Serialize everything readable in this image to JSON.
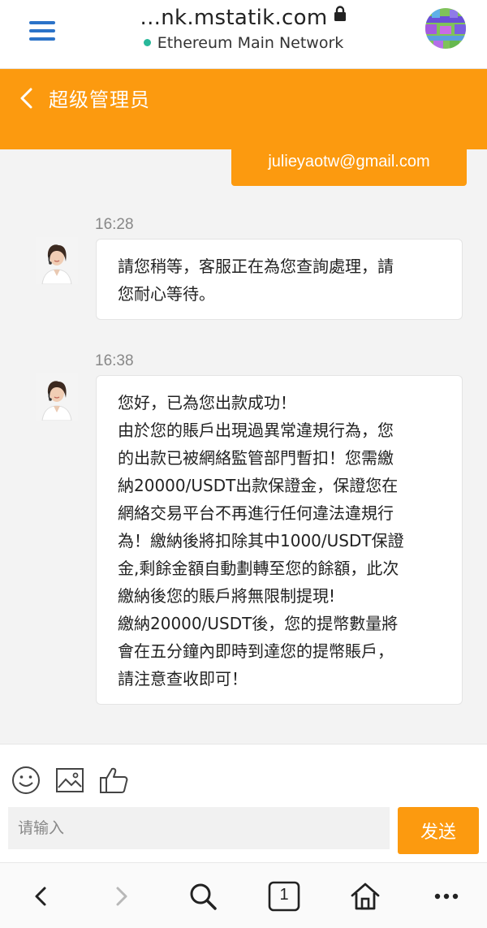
{
  "browser": {
    "url": "...nk.mstatik.com",
    "network": "Ethereum Main Network",
    "accent_color": "#2b73c8",
    "network_status_color": "#28b89a"
  },
  "chat_header": {
    "title": "超级管理员",
    "background_color": "#fc9a0f"
  },
  "messages": {
    "sent": {
      "text": "julieyaotw@gmail.com"
    },
    "received": [
      {
        "time": "16:28",
        "lines": [
          "請您稍等，客服正在為您查詢處理，請",
          "您耐心等待。"
        ]
      },
      {
        "time": "16:38",
        "lines": [
          "您好，已為您出款成功！",
          "由於您的賬戶出現過異常違規行為，您",
          "的出款已被網絡監管部門暫扣！您需繳",
          "納20000/USDT出款保證金，保證您在",
          "網絡交易平台不再進行任何違法違規行",
          "為！繳納後將扣除其中1000/USDT保證",
          "金,剩餘金額自動劃轉至您的餘額，此次",
          "繳納後您的賬戶將無限制提現!",
          "繳納20000/USDT後，您的提幣數量將",
          "會在五分鐘內即時到達您的提幣賬戶，",
          "請注意查收即可！"
        ]
      }
    ]
  },
  "input_area": {
    "placeholder": "请输入",
    "send_label": "发送",
    "tools": [
      "emoji-icon",
      "image-icon",
      "thumbs-up-icon"
    ]
  },
  "bottom_nav": {
    "tab_count": "1",
    "items": [
      "back-icon",
      "forward-icon",
      "search-icon",
      "tabs-icon",
      "home-icon",
      "more-icon"
    ]
  }
}
